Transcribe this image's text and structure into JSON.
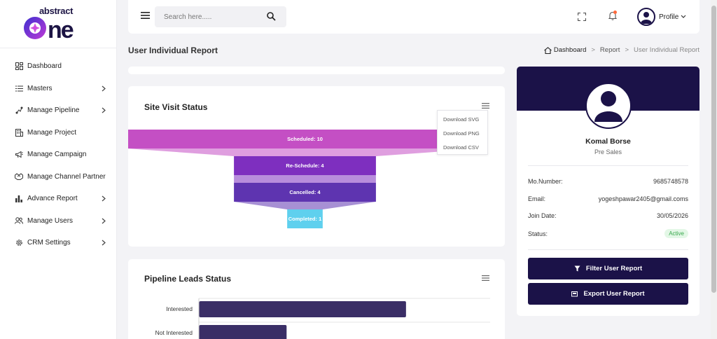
{
  "app": {
    "logo_top": "abstract",
    "logo_main": "one"
  },
  "sidebar": {
    "items": [
      {
        "label": "Dashboard",
        "icon": "dashboard-icon",
        "has_children": false
      },
      {
        "label": "Masters",
        "icon": "list-icon",
        "has_children": true
      },
      {
        "label": "Manage Pipeline",
        "icon": "pipeline-icon",
        "has_children": true
      },
      {
        "label": "Manage Project",
        "icon": "building-icon",
        "has_children": false
      },
      {
        "label": "Manage Campaign",
        "icon": "megaphone-icon",
        "has_children": false
      },
      {
        "label": "Manage Channel Partner",
        "icon": "handshake-icon",
        "has_children": false
      },
      {
        "label": "Advance Report",
        "icon": "bar-chart-icon",
        "has_children": true
      },
      {
        "label": "Manage Users",
        "icon": "users-icon",
        "has_children": true
      },
      {
        "label": "CRM Settings",
        "icon": "gear-icon",
        "has_children": true
      }
    ]
  },
  "topbar": {
    "search_placeholder": "Search here.....",
    "profile_label": "Profile"
  },
  "page": {
    "title": "User Individual Report",
    "breadcrumb": [
      "Dashboard",
      "Report",
      "User Individual Report"
    ]
  },
  "site_visit": {
    "title": "Site Visit Status",
    "menu_options": [
      "Download SVG",
      "Download PNG",
      "Download CSV"
    ]
  },
  "pipeline": {
    "title": "Pipeline Leads Status"
  },
  "chart_data": [
    {
      "type": "funnel",
      "title": "Site Visit Status",
      "categories": [
        "Scheduled",
        "Re-Schedule",
        "Cancelled",
        "Completed"
      ],
      "values": [
        10,
        4,
        4,
        1
      ],
      "labels": [
        "Scheduled: 10",
        "Re-Schedule: 4",
        "Cancelled: 4",
        "Completed: 1"
      ],
      "colors": [
        "#c44fc4",
        "#7e2fbf",
        "#5e34b0",
        "#5fd0ee"
      ]
    },
    {
      "type": "bar",
      "orientation": "horizontal",
      "title": "Pipeline Leads Status",
      "categories": [
        "Interested",
        "Not Interested"
      ],
      "values": [
        7.1,
        3
      ],
      "xlim": [
        0,
        10
      ],
      "color": "#3a2e66"
    }
  ],
  "user": {
    "name": "Komal Borse",
    "role": "Pre Sales",
    "fields": [
      {
        "label": "Mo.Number:",
        "value": "9685748578"
      },
      {
        "label": "Email:",
        "value": "yogeshpawar2405@gmail.coms"
      },
      {
        "label": "Join Date:",
        "value": "30/05/2026"
      },
      {
        "label": "Status:",
        "value": "Active"
      }
    ],
    "filter_button": "Filter User Report",
    "export_button": "Export User Report"
  },
  "colors": {
    "brand": "#1b1248",
    "active_badge": "#38a84d"
  }
}
